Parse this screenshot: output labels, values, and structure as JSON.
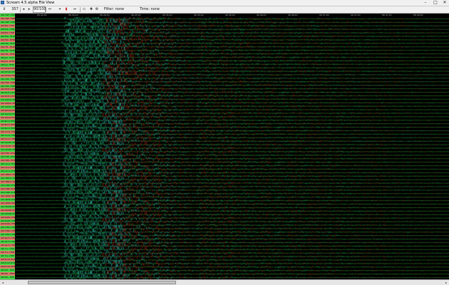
{
  "window": {
    "title": "Scream 4.5 alpha File View"
  },
  "titlebar": {
    "minimize": "–",
    "maximize": "□",
    "close": "✕"
  },
  "toolbar": {
    "items": [
      {
        "name": "filter-icon",
        "label": "⇕"
      },
      {
        "name": "zoom-value",
        "label": "357"
      },
      {
        "name": "step-back-button",
        "label": "◂"
      },
      {
        "name": "play-button",
        "label": "▸"
      },
      {
        "name": "sample-rate",
        "label": "90/100"
      },
      {
        "name": "timebase-button",
        "label": "↔"
      },
      {
        "name": "trigger-button",
        "label": "⌖"
      },
      {
        "name": "marker-icon",
        "label": "▮"
      },
      {
        "name": "fit-button",
        "label": "⇔"
      },
      {
        "name": "window-icon",
        "label": "▭"
      },
      {
        "name": "pick-button",
        "label": "✚"
      },
      {
        "name": "settings-button",
        "label": "⚙"
      }
    ],
    "filter_label": "Filter: none",
    "time_label": "Time: none"
  },
  "sidebar": {
    "colors": {
      "even": "#44d844",
      "odd": "#e07b6a"
    },
    "channels": [
      "GB.CWF..HHZ",
      "GB.CWF..HHN",
      "GB.CWF..HHE",
      "GB.EDI..HHZ",
      "GB.EDI..HHN",
      "GB.EDI..HHE",
      "GB.ESK..HHZ",
      "GB.ESK..HHN",
      "GB.ESK..HHE",
      "GB.HTL..HHZ",
      "GB.HTL..HHN",
      "GB.HTL..HHE",
      "GB.JSA..HHZ",
      "GB.JSA..HHN",
      "GB.JSA..HHE",
      "GB.KESW.HHZ",
      "GB.KESW.HHN",
      "GB.KESW.HHE",
      "GB.LMK..HHZ",
      "GB.LMK..HHN",
      "GB.LMK..HHE",
      "GB.MCH1.HHZ",
      "GB.MCH1.HHN",
      "GB.MCH1.HHE",
      "GB.SWN1.HHZ",
      "GB.SWN1.HHN",
      "GB.SWN1.HHE",
      "GB.WACR.HHZ",
      "GB.WACR.HHN",
      "GB.WACR.HHE",
      "GB.BIGH.HHZ",
      "GB.BIGH.HHN",
      "GB.BIGH.HHE",
      "GB.CCA1.HHZ",
      "GB.CCA1.HHN",
      "GB.CCA1.HHE",
      "GB.DRUM.HHZ",
      "GB.DRUM.HHN",
      "GB.DRUM.HHE",
      "GB.FOEL.HHZ",
      "GB.FOEL.HHN",
      "GB.FOEL.HHE",
      "GB.GAL1.HHZ",
      "GB.GAL1.HHN",
      "GB.GAL1.HHE",
      "GB.HMNX.HHZ",
      "GB.HMNX.HHN",
      "GB.HMNX.HHE",
      "GB.IOMK.HHZ",
      "GB.IOMK.HHN",
      "GB.IOMK.HHE",
      "GB.LBWR.HHZ",
      "GB.LBWR.HHN",
      "GB.LBWR.HHE",
      "GB.MONM.HHZ",
      "GB.MONM.HHN",
      "GB.MONM.HHE",
      "GB.PGB1.HHZ",
      "GB.PGB1.HHN",
      "GB.PGB1.HHE",
      "GB.STNC.HHZ",
      "GB.STNC.HHN",
      "GB.STNC.HHE",
      "GB.WLF1.HHZ",
      "GB.WLF1.HHN",
      "GB.WLF1.HHE",
      "GB.YLL..HHZ",
      "GB.YLL..HHN",
      "GB.YLL..HHE",
      "GB.ELSH.HHZ",
      "GB.ELSH.HHN",
      "GB.ELSH.HHE",
      "GB.KPL..HHZ",
      "GB.KPL..HHN",
      "GB.KPL..HHE"
    ]
  },
  "time_axis": {
    "ticks": [
      "06:44:00",
      "06:44:20",
      "06:44:40",
      "06:45:00",
      "06:45:20",
      "06:45:40",
      "06:46:00",
      "06:46:20",
      "06:46:40",
      "06:47:00",
      "06:47:20",
      "06:47:40",
      "06:48:00"
    ]
  },
  "plot": {
    "trace_count": 75,
    "colors": {
      "noise": "#1fd07a",
      "s_wave": "#d8301c",
      "p_wave": "#3ef0e6",
      "baseline": "#3fd23f",
      "background": "#000000"
    },
    "p_arrival_fraction": 0.11,
    "s_arrival_fraction": 0.205,
    "coda_end_fraction": 0.42
  },
  "scrollbar": {
    "position_fraction": 0.05,
    "visible_fraction": 0.34
  }
}
